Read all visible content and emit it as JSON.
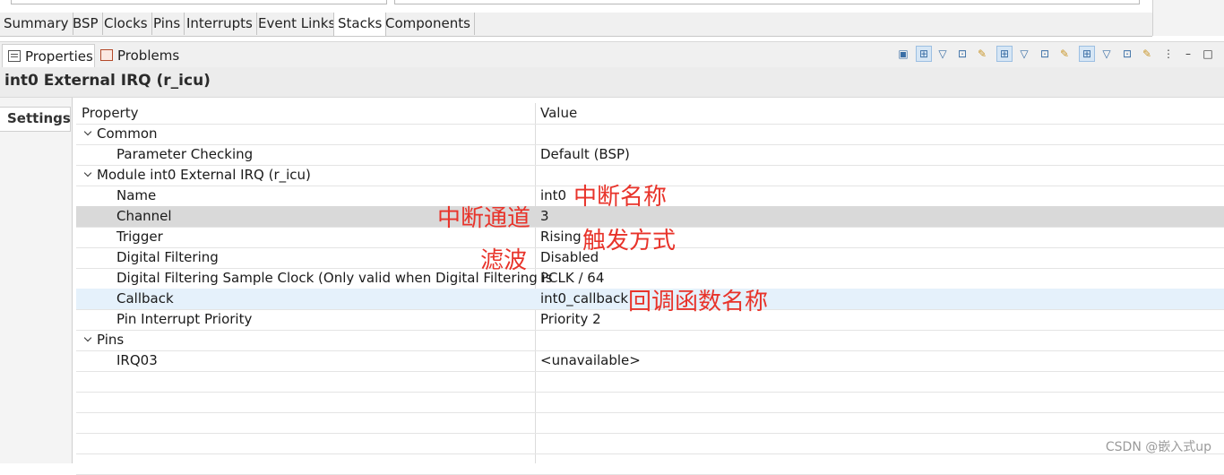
{
  "editor_tabs": [
    "Summary",
    "BSP",
    "Clocks",
    "Pins",
    "Interrupts",
    "Event Links",
    "Stacks",
    "Components"
  ],
  "active_editor_tab": "Stacks",
  "views": {
    "properties_label": "Properties",
    "problems_label": "Problems"
  },
  "panel_title": "int0 External IRQ (r_icu)",
  "side_tab": "Settings",
  "table": {
    "col_property": "Property",
    "col_value": "Value",
    "rows": [
      {
        "property": "Common",
        "value": "",
        "group": true
      },
      {
        "property": "Parameter Checking",
        "value": "Default (BSP)"
      },
      {
        "property": "Module int0 External IRQ (r_icu)",
        "value": "",
        "group": true
      },
      {
        "property": "Name",
        "value": "int0"
      },
      {
        "property": "Channel",
        "value": "3",
        "selected": true
      },
      {
        "property": "Trigger",
        "value": "Rising"
      },
      {
        "property": "Digital Filtering",
        "value": "Disabled"
      },
      {
        "property": "Digital Filtering Sample Clock (Only valid when Digital Filtering is",
        "value": "PCLK / 64"
      },
      {
        "property": "Callback",
        "value": "int0_callback",
        "hover": true
      },
      {
        "property": "Pin Interrupt Priority",
        "value": "Priority 2"
      },
      {
        "property": "Pins",
        "value": "",
        "group": true
      },
      {
        "property": "IRQ03",
        "value": "<unavailable>"
      }
    ]
  },
  "annotations": {
    "name": "中断名称",
    "channel": "中断通道",
    "trigger": "触发方式",
    "filter": "滤波",
    "callback": "回调函数名称"
  },
  "watermark": "CSDN @嵌入式up",
  "colors": {
    "annotation": "#e8332a",
    "selected_row": "#d9d9d9",
    "hover_row": "#e5f1fb"
  }
}
